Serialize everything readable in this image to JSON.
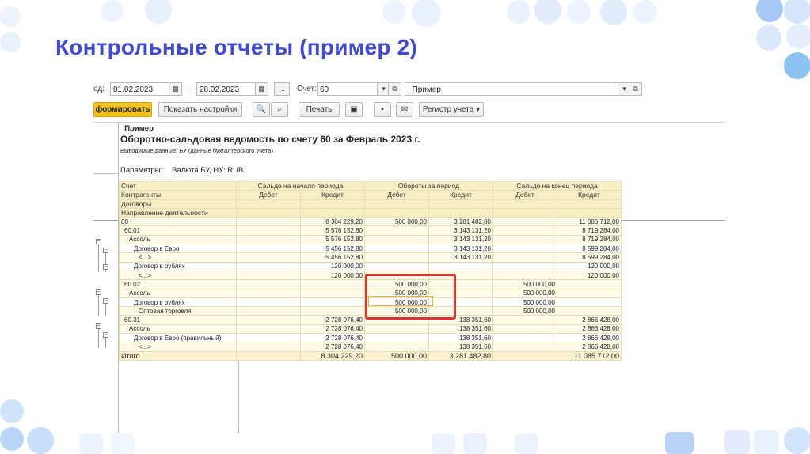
{
  "slide": {
    "title": "Контрольные отчеты (пример 2)"
  },
  "params": {
    "period_label": "од:",
    "date_from": "01.02.2023",
    "dash": "–",
    "date_to": "28.02.2023",
    "dots": "...",
    "account_label": "Счет:",
    "account_value": "60",
    "org_value": "_Пример"
  },
  "toolbar": {
    "generate": "формировать",
    "settings": "Показать настройки",
    "print": "Печать",
    "register": "Регистр учета"
  },
  "report": {
    "org": "_Пример",
    "title": "Оборотно-сальдовая ведомость по счету 60 за Февраль 2023 г.",
    "output": "Выводимые данные: БУ (данные бухгалтерского учета)",
    "params_label": "Параметры:",
    "params_value": "Валюта БУ, НУ: RUB"
  },
  "columns": {
    "c1": [
      "Счет",
      "Контрагенты",
      "Договоры",
      "Направление деятельности"
    ],
    "opening": "Сальдо на начало периода",
    "turnover": "Обороты за период",
    "closing": "Сальдо на конец периода",
    "debit": "Дебет",
    "credit": "Кредит"
  },
  "rows": [
    {
      "name": "60",
      "ob_d": "",
      "ob_c": "8 304 229,20",
      "t_d": "500 000,00",
      "t_c": "3 281 482,80",
      "cb_d": "",
      "cb_c": "11 085 712,00"
    },
    {
      "name": "60.01",
      "ob_d": "",
      "ob_c": "5 576 152,80",
      "t_d": "",
      "t_c": "3 143 131,20",
      "cb_d": "",
      "cb_c": "8 719 284,00"
    },
    {
      "name": "Ассоль",
      "ob_d": "",
      "ob_c": "5 576 152,80",
      "t_d": "",
      "t_c": "3 143 131,20",
      "cb_d": "",
      "cb_c": "8 719 284,00"
    },
    {
      "name": "Договор в Евро",
      "ob_d": "",
      "ob_c": "5 456 152,80",
      "t_d": "",
      "t_c": "3 143 131,20",
      "cb_d": "",
      "cb_c": "8 599 284,00"
    },
    {
      "name": "<...>",
      "ob_d": "",
      "ob_c": "5 456 152,80",
      "t_d": "",
      "t_c": "3 143 131,20",
      "cb_d": "",
      "cb_c": "8 599 284,00"
    },
    {
      "name": "Договор в рублях",
      "ob_d": "",
      "ob_c": "120 000,00",
      "t_d": "",
      "t_c": "",
      "cb_d": "",
      "cb_c": "120 000,00"
    },
    {
      "name": "<...>",
      "ob_d": "",
      "ob_c": "120 000,00",
      "t_d": "",
      "t_c": "",
      "cb_d": "",
      "cb_c": "120 000,00"
    },
    {
      "name": "60.02",
      "ob_d": "",
      "ob_c": "",
      "t_d": "500 000,00",
      "t_c": "",
      "cb_d": "500 000,00",
      "cb_c": ""
    },
    {
      "name": "Ассоль",
      "ob_d": "",
      "ob_c": "",
      "t_d": "500 000,00",
      "t_c": "",
      "cb_d": "500 000,00",
      "cb_c": ""
    },
    {
      "name": "Договор в рублях",
      "ob_d": "",
      "ob_c": "",
      "t_d": "500 000,00",
      "t_c": "",
      "cb_d": "500 000,00",
      "cb_c": ""
    },
    {
      "name": "Оптовая торговля",
      "ob_d": "",
      "ob_c": "",
      "t_d": "500 000,00",
      "t_c": "",
      "cb_d": "500 000,00",
      "cb_c": ""
    },
    {
      "name": "60.31",
      "ob_d": "",
      "ob_c": "2 728 076,40",
      "t_d": "",
      "t_c": "138 351,60",
      "cb_d": "",
      "cb_c": "2 866 428,00"
    },
    {
      "name": "Ассоль",
      "ob_d": "",
      "ob_c": "2 728 076,40",
      "t_d": "",
      "t_c": "138 351,60",
      "cb_d": "",
      "cb_c": "2 866 428,00"
    },
    {
      "name": "Договор в Евро (правильный)",
      "ob_d": "",
      "ob_c": "2 728 076,40",
      "t_d": "",
      "t_c": "138 351,60",
      "cb_d": "",
      "cb_c": "2 866 428,00"
    },
    {
      "name": "<...>",
      "ob_d": "",
      "ob_c": "2 728 076,40",
      "t_d": "",
      "t_c": "138 351,60",
      "cb_d": "",
      "cb_c": "2 866 428,00"
    }
  ],
  "total": {
    "name": "Итого",
    "ob_d": "",
    "ob_c": "8 304 229,20",
    "t_d": "500 000,00",
    "t_c": "3 281 482,80",
    "cb_d": "",
    "cb_c": "11 085 712,00"
  },
  "colors": {
    "title": "#3f4bd0",
    "accent": "#f6c21c",
    "highlight": "#d9362e"
  }
}
